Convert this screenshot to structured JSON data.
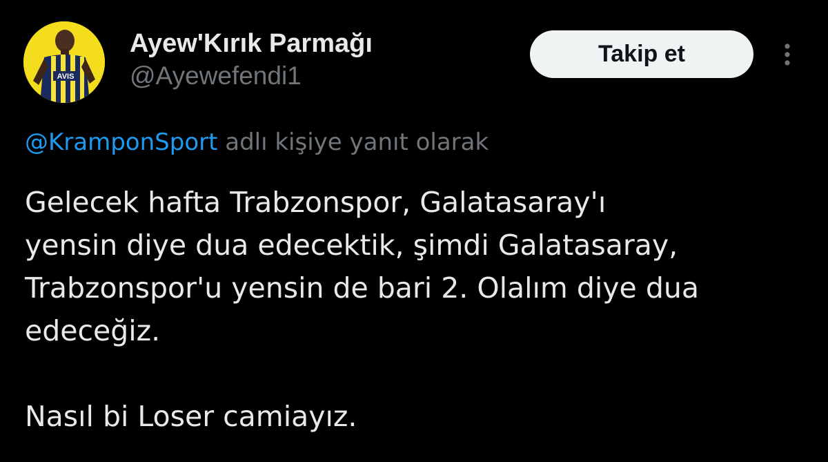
{
  "author": {
    "display_name": "Ayew'Kırık Parmağı",
    "handle": "@Ayewefendi1",
    "avatar_bg_color": "#f3dd1c",
    "avatar_jersey_text": "AVIS"
  },
  "actions": {
    "follow_label": "Takip et",
    "more_icon": "more-vertical-icon"
  },
  "reply_context": {
    "mention": "@KramponSport",
    "suffix": " adlı kişiye yanıt olarak"
  },
  "tweet": {
    "lines": [
      "Gelecek hafta Trabzonspor, Galatasaray'ı",
      "yensin diye dua edecektik, şimdi Galatasaray,",
      "Trabzonspor'u yensin de bari 2. Olalım diye dua",
      "edeceğiz."
    ],
    "closing_line": "Nasıl bi Loser camiayız."
  },
  "colors": {
    "background": "#000000",
    "text": "#e7e9ea",
    "secondary_text": "#71767b",
    "link": "#1d9bf0",
    "button_bg": "#eff3f4",
    "button_text": "#0f1419"
  }
}
